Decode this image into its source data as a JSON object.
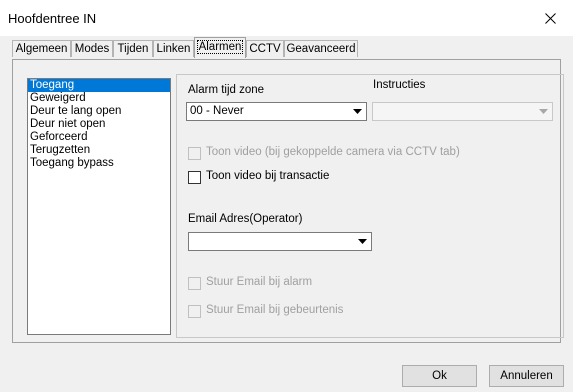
{
  "window": {
    "title": "Hoofdentree IN"
  },
  "tabs": [
    {
      "label": "Algemeen"
    },
    {
      "label": "Modes"
    },
    {
      "label": "Tijden"
    },
    {
      "label": "Linken"
    },
    {
      "label": "Alarmen",
      "active": true
    },
    {
      "label": "CCTV"
    },
    {
      "label": "Geavanceerd"
    }
  ],
  "event_list": [
    {
      "label": "Toegang",
      "selected": true
    },
    {
      "label": "Geweigerd"
    },
    {
      "label": "Deur te lang open"
    },
    {
      "label": "Deur niet open"
    },
    {
      "label": "Geforceerd"
    },
    {
      "label": "Terugzetten"
    },
    {
      "label": "Toegang bypass"
    }
  ],
  "alarm": {
    "timezone_label": "Alarm tijd zone",
    "timezone_value": "00 - Never",
    "instructions_label": "Instructies",
    "instructions_value": ""
  },
  "options": {
    "show_video_camera": "Toon video (bij gekoppelde camera via CCTV tab)",
    "show_video_transaction": "Toon video bij transactie"
  },
  "email": {
    "label": "Email Adres(Operator)",
    "value": "",
    "send_on_alarm": "Stuur Email bij alarm",
    "send_on_event": "Stuur Email bij gebeurtenis"
  },
  "buttons": {
    "ok": "Ok",
    "cancel": "Annuleren"
  }
}
